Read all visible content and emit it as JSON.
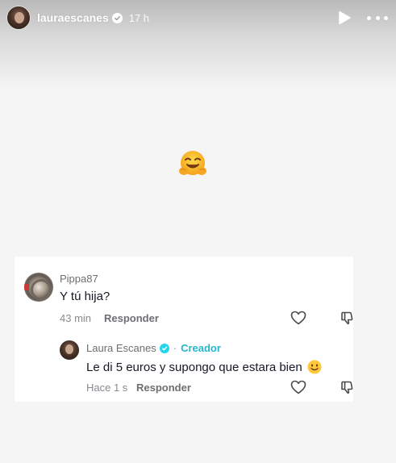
{
  "header": {
    "username": "lauraescanes",
    "time": "17 h",
    "icons": [
      "avatar",
      "verified-badge-icon",
      "play-icon",
      "more-icon"
    ]
  },
  "story": {
    "emoji": "hugging-face-emoji"
  },
  "comment": {
    "user": "Pippa87",
    "text": "Y tú hija?",
    "time": "43 min",
    "reply_label": "Responder",
    "icons": [
      "heart-icon",
      "dislike-icon"
    ]
  },
  "reply": {
    "user": "Laura Escanes",
    "dot": "·",
    "badge_label": "Creador",
    "text": "Le di 5 euros y supongo que estara bien",
    "time": "Hace 1 s",
    "reply_label": "Responder",
    "icons": [
      "verified-badge-icon",
      "smiling-face-emoji",
      "heart-icon",
      "dislike-icon"
    ]
  },
  "colors": {
    "accent_creator": "#25b6c9",
    "verified": "#20d5ec",
    "text_primary": "#161823",
    "text_secondary": "#8a8b91"
  }
}
